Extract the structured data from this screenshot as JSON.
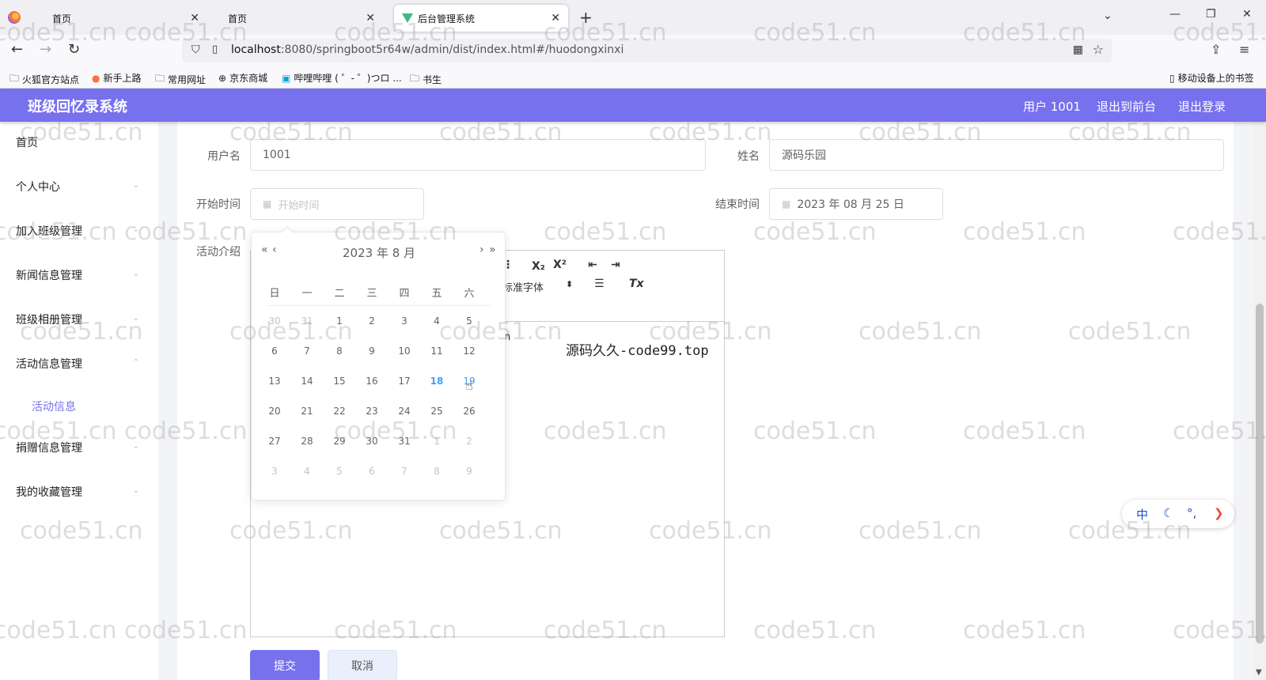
{
  "browser": {
    "tabs": [
      {
        "title": "首页"
      },
      {
        "title": "首页"
      },
      {
        "title": "后台管理系统"
      }
    ],
    "url_host": "localhost",
    "url_rest": ":8080/springboot5r64w/admin/dist/index.html#/huodongxinxi",
    "bookmarks": [
      "火狐官方站点",
      "新手上路",
      "常用网址",
      "京东商城",
      "哔哩哔哩 ( ゜- ゜)つロ ...",
      "书生"
    ],
    "mobile_bookmarks": "移动设备上的书签"
  },
  "header": {
    "title": "班级回忆录系统",
    "user": "用户 1001",
    "back_front": "退出到前台",
    "logout": "退出登录"
  },
  "sidebar": {
    "items": [
      "首页",
      "个人中心",
      "加入班级管理",
      "新闻信息管理",
      "班级相册管理",
      "活动信息管理"
    ],
    "active_sub": "活动信息",
    "items_after": [
      "捐赠信息管理",
      "我的收藏管理"
    ]
  },
  "form": {
    "username_label": "用户名",
    "username_value": "1001",
    "name_label": "姓名",
    "name_value": "源码乐园",
    "start_label": "开始时间",
    "start_placeholder": "开始时间",
    "end_label": "结束时间",
    "end_value": "2023 年 08 月 25 日",
    "intro_label": "活动介绍",
    "editor_font": "标准字体",
    "editor_text": "源码久久-code99.top",
    "editor_fragment": "n",
    "submit": "提交",
    "cancel": "取消"
  },
  "datepicker": {
    "title": "2023 年  8 月",
    "prev_year": "«",
    "prev_month": "‹",
    "next_month": "›",
    "next_year": "»",
    "weekdays": [
      "日",
      "一",
      "二",
      "三",
      "四",
      "五",
      "六"
    ],
    "weeks": [
      [
        "30",
        "31",
        "1",
        "2",
        "3",
        "4",
        "5"
      ],
      [
        "6",
        "7",
        "8",
        "9",
        "10",
        "11",
        "12"
      ],
      [
        "13",
        "14",
        "15",
        "16",
        "17",
        "18",
        "19"
      ],
      [
        "20",
        "21",
        "22",
        "23",
        "24",
        "25",
        "26"
      ],
      [
        "27",
        "28",
        "29",
        "30",
        "31",
        "1",
        "2"
      ],
      [
        "3",
        "4",
        "5",
        "6",
        "7",
        "8",
        "9"
      ]
    ],
    "today": "18"
  },
  "ime": {
    "lang": "中",
    "moon": "☾",
    "punct": "°,",
    "arrow": "❯"
  },
  "watermark": "code51.cn",
  "colors": {
    "accent": "#7771ee",
    "today": "#409eff"
  }
}
